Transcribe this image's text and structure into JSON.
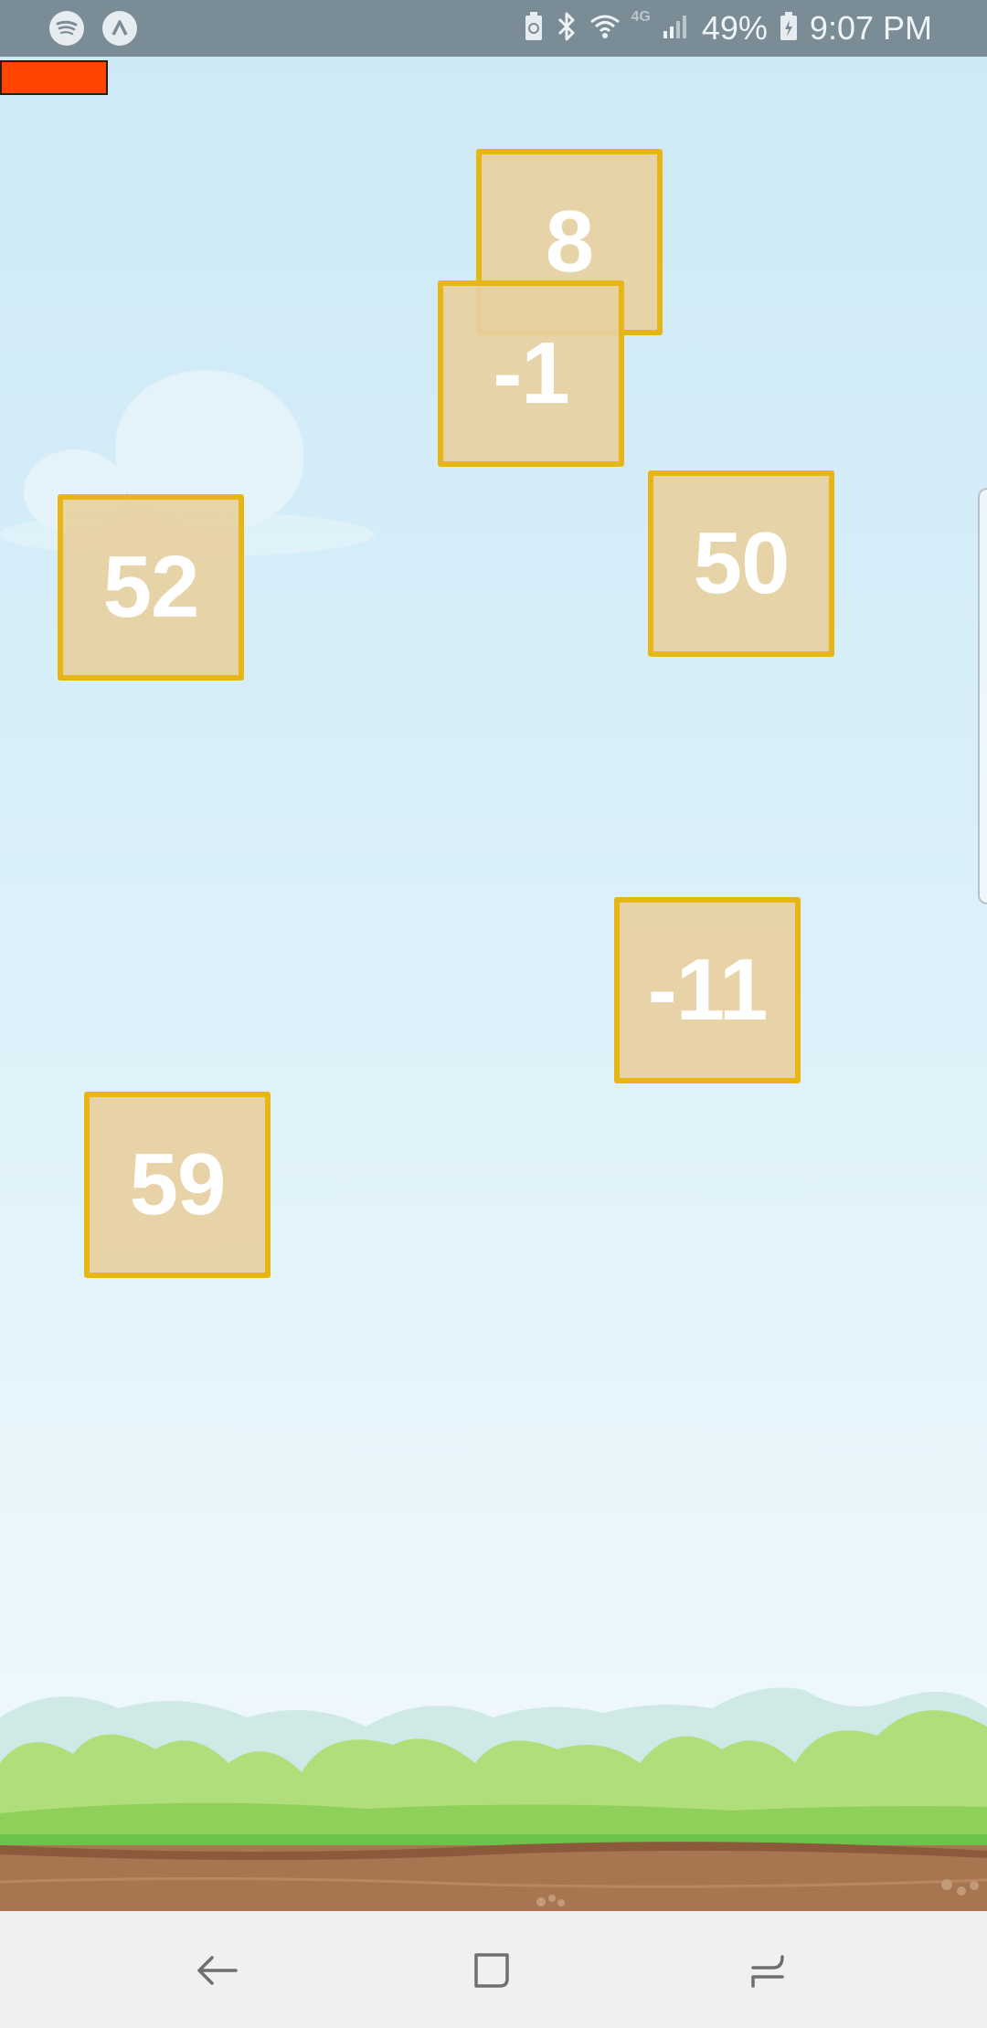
{
  "status_bar": {
    "battery_percent": "49%",
    "time": "9:07 PM",
    "network_label": "4G",
    "icons": [
      "spotify-icon",
      "arrow-app-icon",
      "battery-saver-icon",
      "bluetooth-icon",
      "wifi-icon",
      "signal-icon",
      "battery-icon"
    ]
  },
  "game": {
    "health_bar": {
      "color": "#ff4500",
      "fill": 1.0
    },
    "tiles": [
      {
        "value": "8"
      },
      {
        "value": "-1"
      },
      {
        "value": "52"
      },
      {
        "value": "50"
      },
      {
        "value": "-11"
      },
      {
        "value": "59"
      }
    ],
    "colors": {
      "tile_border": "#e8b614",
      "tile_fill": "#e7d0a0",
      "grass": "#a6dc6c",
      "dirt": "#a87650"
    }
  },
  "nav_bar": {
    "icons": [
      "back-icon",
      "home-icon",
      "recents-icon"
    ]
  }
}
